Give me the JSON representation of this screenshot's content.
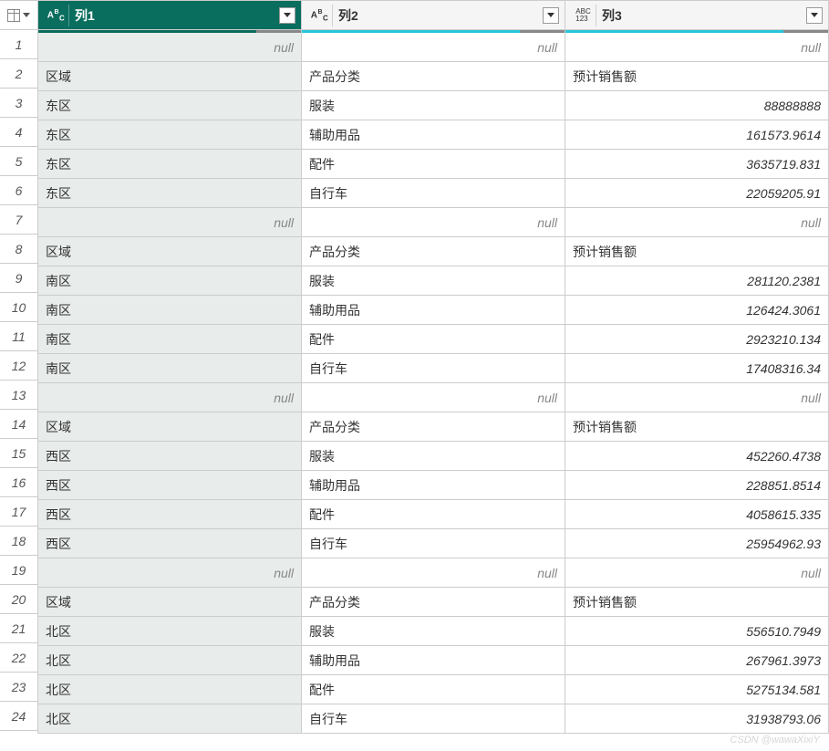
{
  "columns": [
    {
      "name": "列1",
      "type_label": "ABC",
      "selected": true,
      "quality": {
        "valid": 83,
        "error": 17
      }
    },
    {
      "name": "列2",
      "type_label": "ABC",
      "selected": false,
      "quality": {
        "valid": 83,
        "error": 17
      }
    },
    {
      "name": "列3",
      "type_label": "ABC123",
      "selected": false,
      "quality": {
        "valid": 83,
        "error": 17
      }
    }
  ],
  "null_text": "null",
  "rows": [
    {
      "n": "1",
      "c": [
        {
          "v": null
        },
        {
          "v": null
        },
        {
          "v": null
        }
      ]
    },
    {
      "n": "2",
      "c": [
        {
          "v": "区域"
        },
        {
          "v": "产品分类"
        },
        {
          "v": "预计销售额"
        }
      ]
    },
    {
      "n": "3",
      "c": [
        {
          "v": "东区"
        },
        {
          "v": "服装"
        },
        {
          "v": "88888888",
          "r": true
        }
      ]
    },
    {
      "n": "4",
      "c": [
        {
          "v": "东区"
        },
        {
          "v": "辅助用品"
        },
        {
          "v": "161573.9614",
          "r": true
        }
      ]
    },
    {
      "n": "5",
      "c": [
        {
          "v": "东区"
        },
        {
          "v": "配件"
        },
        {
          "v": "3635719.831",
          "r": true
        }
      ]
    },
    {
      "n": "6",
      "c": [
        {
          "v": "东区"
        },
        {
          "v": "自行车"
        },
        {
          "v": "22059205.91",
          "r": true
        }
      ]
    },
    {
      "n": "7",
      "c": [
        {
          "v": null
        },
        {
          "v": null
        },
        {
          "v": null
        }
      ]
    },
    {
      "n": "8",
      "c": [
        {
          "v": "区域"
        },
        {
          "v": "产品分类"
        },
        {
          "v": "预计销售额"
        }
      ]
    },
    {
      "n": "9",
      "c": [
        {
          "v": "南区"
        },
        {
          "v": "服装"
        },
        {
          "v": "281120.2381",
          "r": true
        }
      ]
    },
    {
      "n": "10",
      "c": [
        {
          "v": "南区"
        },
        {
          "v": "辅助用品"
        },
        {
          "v": "126424.3061",
          "r": true
        }
      ]
    },
    {
      "n": "11",
      "c": [
        {
          "v": "南区"
        },
        {
          "v": "配件"
        },
        {
          "v": "2923210.134",
          "r": true
        }
      ]
    },
    {
      "n": "12",
      "c": [
        {
          "v": "南区"
        },
        {
          "v": "自行车"
        },
        {
          "v": "17408316.34",
          "r": true
        }
      ]
    },
    {
      "n": "13",
      "c": [
        {
          "v": null
        },
        {
          "v": null
        },
        {
          "v": null
        }
      ]
    },
    {
      "n": "14",
      "c": [
        {
          "v": "区域"
        },
        {
          "v": "产品分类"
        },
        {
          "v": "预计销售额"
        }
      ]
    },
    {
      "n": "15",
      "c": [
        {
          "v": "西区"
        },
        {
          "v": "服装"
        },
        {
          "v": "452260.4738",
          "r": true
        }
      ]
    },
    {
      "n": "16",
      "c": [
        {
          "v": "西区"
        },
        {
          "v": "辅助用品"
        },
        {
          "v": "228851.8514",
          "r": true
        }
      ]
    },
    {
      "n": "17",
      "c": [
        {
          "v": "西区"
        },
        {
          "v": "配件"
        },
        {
          "v": "4058615.335",
          "r": true
        }
      ]
    },
    {
      "n": "18",
      "c": [
        {
          "v": "西区"
        },
        {
          "v": "自行车"
        },
        {
          "v": "25954962.93",
          "r": true
        }
      ]
    },
    {
      "n": "19",
      "c": [
        {
          "v": null
        },
        {
          "v": null
        },
        {
          "v": null
        }
      ]
    },
    {
      "n": "20",
      "c": [
        {
          "v": "区域"
        },
        {
          "v": "产品分类"
        },
        {
          "v": "预计销售额"
        }
      ]
    },
    {
      "n": "21",
      "c": [
        {
          "v": "北区"
        },
        {
          "v": "服装"
        },
        {
          "v": "556510.7949",
          "r": true
        }
      ]
    },
    {
      "n": "22",
      "c": [
        {
          "v": "北区"
        },
        {
          "v": "辅助用品"
        },
        {
          "v": "267961.3973",
          "r": true
        }
      ]
    },
    {
      "n": "23",
      "c": [
        {
          "v": "北区"
        },
        {
          "v": "配件"
        },
        {
          "v": "5275134.581",
          "r": true
        }
      ]
    },
    {
      "n": "24",
      "c": [
        {
          "v": "北区"
        },
        {
          "v": "自行车"
        },
        {
          "v": "31938793.06",
          "r": true
        }
      ]
    }
  ],
  "watermark": "CSDN @wawaXixiY"
}
